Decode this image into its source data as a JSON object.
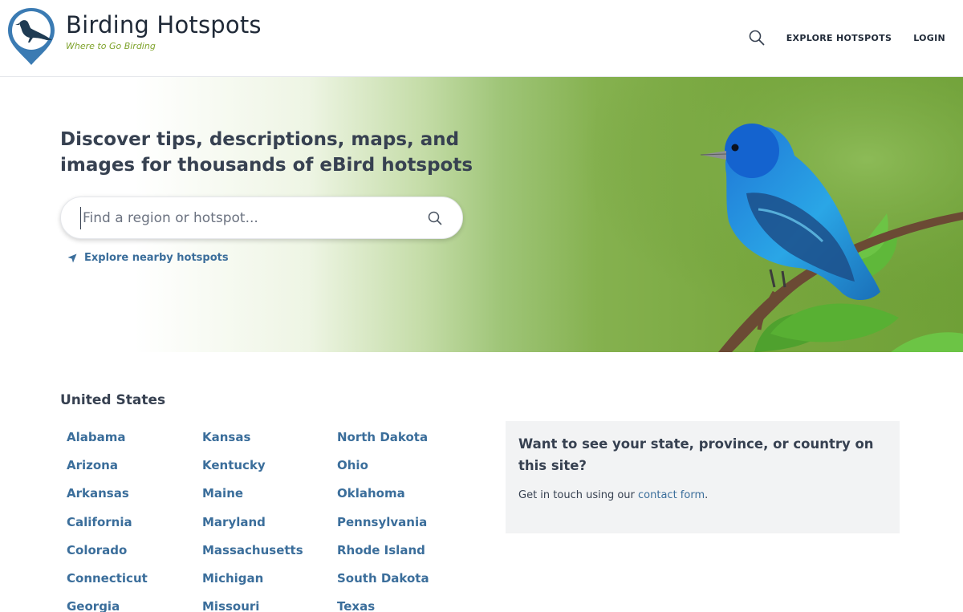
{
  "site": {
    "title": "Birding Hotspots",
    "tagline": "Where to Go Birding"
  },
  "nav": {
    "search_icon": "search-icon",
    "explore_label": "EXPLORE HOTSPOTS",
    "login_label": "LOGIN"
  },
  "hero": {
    "heading": "Discover tips, descriptions, maps, and images for thousands of eBird hotspots",
    "search_placeholder": "Find a region or hotspot...",
    "nearby_label": "Explore nearby hotspots",
    "image_subject": "indigo bunting on branch"
  },
  "regions": {
    "title": "United States",
    "columns": [
      [
        "Alabama",
        "Arizona",
        "Arkansas",
        "California",
        "Colorado",
        "Connecticut",
        "Georgia"
      ],
      [
        "Kansas",
        "Kentucky",
        "Maine",
        "Maryland",
        "Massachusetts",
        "Michigan",
        "Missouri"
      ],
      [
        "North Dakota",
        "Ohio",
        "Oklahoma",
        "Pennsylvania",
        "Rhode Island",
        "South Dakota",
        "Texas"
      ]
    ]
  },
  "info": {
    "title": "Want to see your state, province, or country on this site?",
    "text_prefix": "Get in touch using our ",
    "link_label": "contact form",
    "text_suffix": "."
  },
  "colors": {
    "brand_blue": "#3b7bb3",
    "link_blue": "#3b6e9b",
    "tagline_green": "#7fa32c",
    "hero_green": "#79a83f",
    "info_bg": "#f2f3f4"
  }
}
